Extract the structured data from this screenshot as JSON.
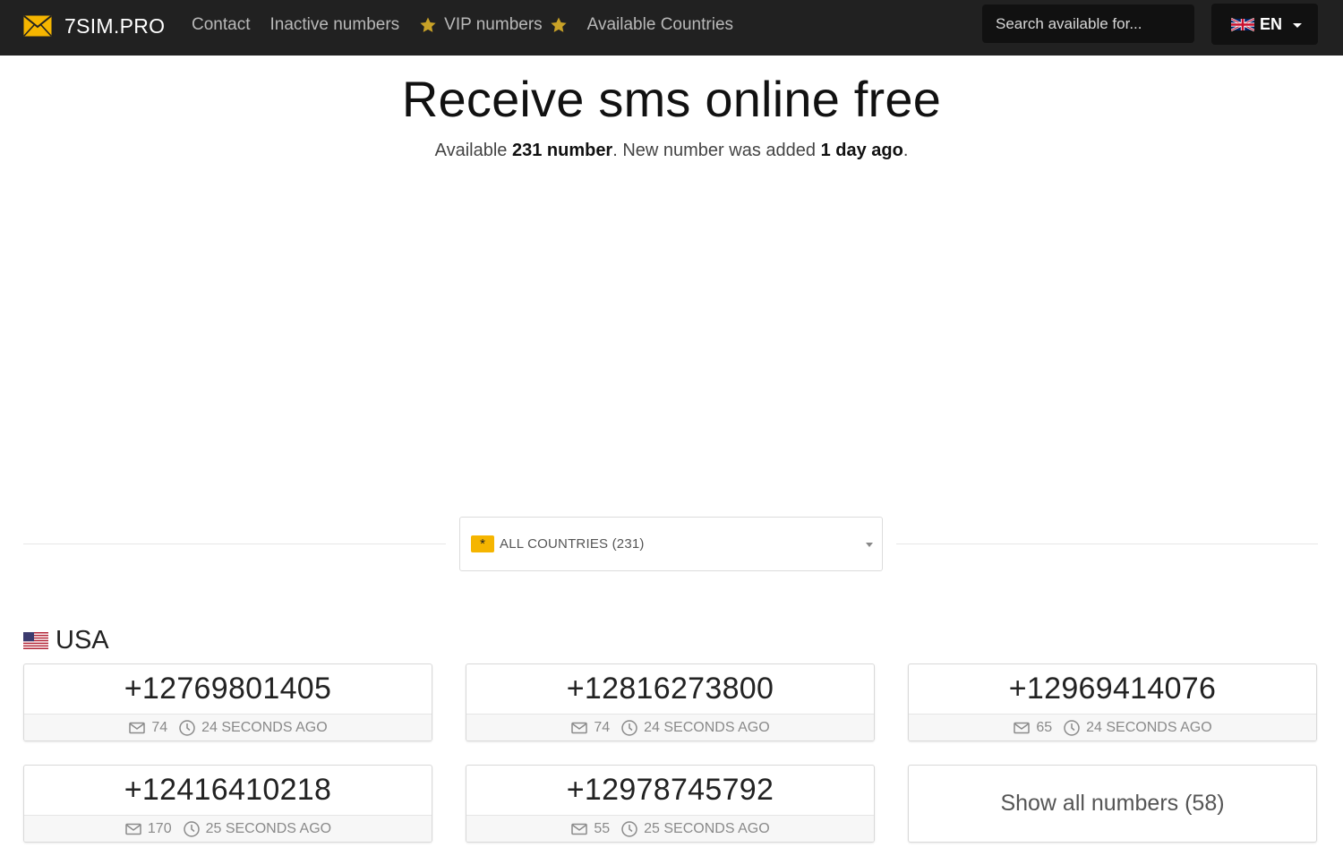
{
  "colors": {
    "navbar_bg": "#212121",
    "accent": "#f5b500",
    "badge": "#f5b500"
  },
  "navbar": {
    "brand": {
      "text": "7SIM.PRO",
      "icon": "envelope-icon"
    },
    "links": [
      {
        "label": "Contact"
      },
      {
        "label": "Inactive numbers"
      },
      {
        "label": "VIP numbers",
        "icon": "star-icon"
      },
      {
        "label": "Available Countries"
      }
    ],
    "search": {
      "placeholder": "Search available for...",
      "value": ""
    },
    "language": {
      "code": "EN",
      "icon": "uk-flag-icon"
    }
  },
  "hero": {
    "title": "Receive sms online free",
    "subtitle_prefix": "Available ",
    "count_text": "231 number",
    "subtitle_middle": ". New number was added ",
    "added_text": "1 day ago",
    "subtitle_suffix": "."
  },
  "country_select": {
    "badge": "*",
    "selected": "ALL COUNTRIES (231)"
  },
  "country": {
    "name": "USA",
    "icon": "us-flag-icon"
  },
  "numbers": [
    {
      "number": "+12769801405",
      "messages": "74",
      "time": "24 SECONDS AGO"
    },
    {
      "number": "+12816273800",
      "messages": "74",
      "time": "24 SECONDS AGO"
    },
    {
      "number": "+12969414076",
      "messages": "65",
      "time": "24 SECONDS AGO"
    },
    {
      "number": "+12416410218",
      "messages": "170",
      "time": "25 SECONDS AGO"
    },
    {
      "number": "+12978745792",
      "messages": "55",
      "time": "25 SECONDS AGO"
    }
  ],
  "show_all": {
    "label": "Show all numbers (58)"
  }
}
